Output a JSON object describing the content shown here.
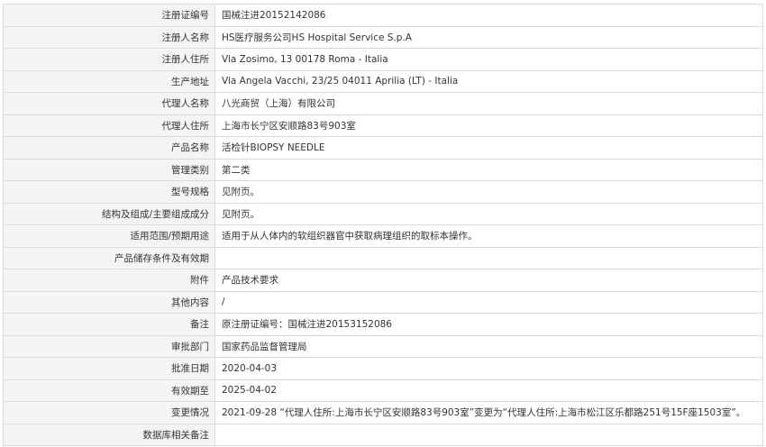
{
  "rows": [
    {
      "label": "注册证编号",
      "value": "国械注进20152142086"
    },
    {
      "label": "注册人名称",
      "value": "HS医疗服务公司HS Hospital Service S.p.A"
    },
    {
      "label": "注册人住所",
      "value": "Via Zosimo, 13 00178 Roma - Italia"
    },
    {
      "label": "生产地址",
      "value": "Via Angela Vacchi, 23/25 04011 Aprilia (LT) - Italia"
    },
    {
      "label": "代理人名称",
      "value": "八光商贸（上海）有限公司"
    },
    {
      "label": "代理人住所",
      "value": "上海市长宁区安顺路83号903室"
    },
    {
      "label": "产品名称",
      "value": "活检针BIOPSY NEEDLE"
    },
    {
      "label": "管理类别",
      "value": "第二类"
    },
    {
      "label": "型号规格",
      "value": "见附页。"
    },
    {
      "label": "结构及组成/主要组成成分",
      "value": "见附页。"
    },
    {
      "label": "适用范围/预期用途",
      "value": "适用于从人体内的软组织器官中获取病理组织的取标本操作。"
    },
    {
      "label": "产品储存条件及有效期",
      "value": ""
    },
    {
      "label": "附件",
      "value": "产品技术要求"
    },
    {
      "label": "其他内容",
      "value": "/"
    },
    {
      "label": "备注",
      "value": "原注册证编号：国械注进20153152086"
    },
    {
      "label": "审批部门",
      "value": "国家药品监督管理局"
    },
    {
      "label": "批准日期",
      "value": "2020-04-03"
    },
    {
      "label": "有效期至",
      "value": "2025-04-02"
    },
    {
      "label": "变更情况",
      "value": "2021-09-28 “代理人住所:上海市长宁区安顺路83号903室”变更为“代理人住所:上海市松江区乐都路251号15F座1503室”。"
    },
    {
      "label": "数据库相关备注",
      "value": ""
    }
  ]
}
